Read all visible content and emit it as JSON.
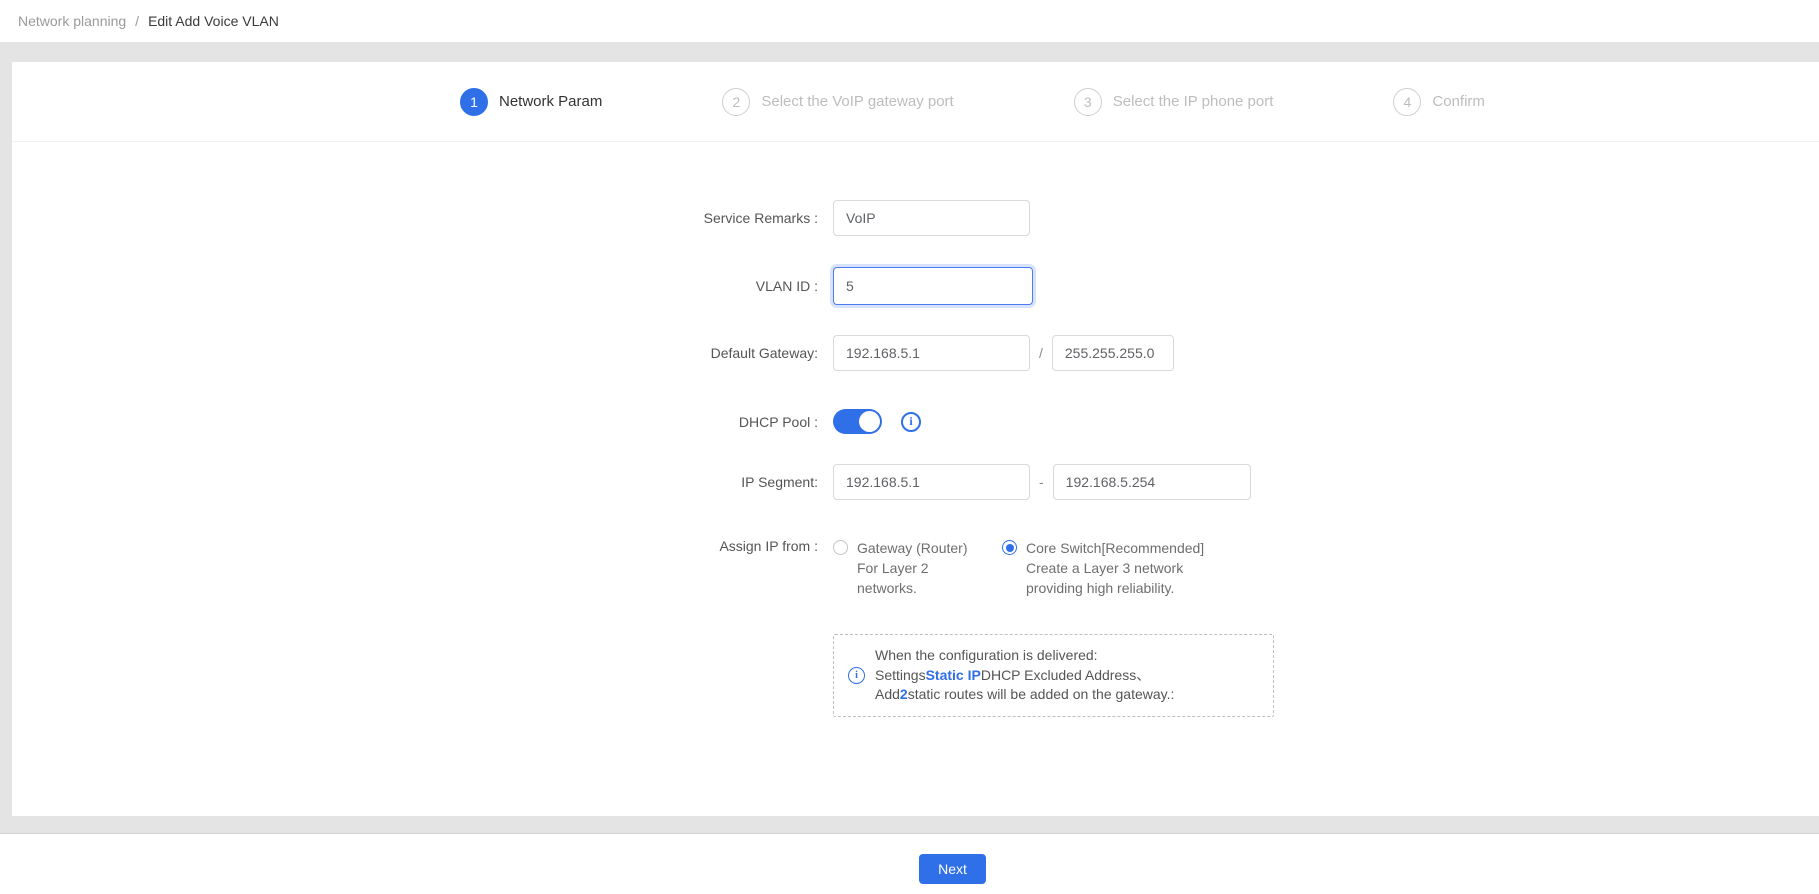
{
  "breadcrumb": {
    "parent": "Network planning",
    "separator": "/",
    "current": "Edit Add Voice VLAN"
  },
  "steps": [
    {
      "number": "1",
      "label": "Network Param",
      "active": true
    },
    {
      "number": "2",
      "label": "Select the VoIP gateway port",
      "active": false
    },
    {
      "number": "3",
      "label": "Select the IP phone port",
      "active": false
    },
    {
      "number": "4",
      "label": "Confirm",
      "active": false
    }
  ],
  "form": {
    "service_remarks": {
      "label": "Service Remarks :",
      "value": "VoIP"
    },
    "vlan_id": {
      "label": "VLAN ID :",
      "value": "5"
    },
    "default_gateway": {
      "label": "Default Gateway:",
      "ip": "192.168.5.1",
      "separator": "/",
      "mask": "255.255.255.0"
    },
    "dhcp_pool": {
      "label": "DHCP Pool :",
      "enabled": true
    },
    "ip_segment": {
      "label": "IP Segment:",
      "start": "192.168.5.1",
      "separator": "-",
      "end": "192.168.5.254"
    },
    "assign_ip_from": {
      "label": "Assign IP from :",
      "options": [
        {
          "selected": false,
          "lines": [
            "Gateway (Router)",
            "For Layer 2",
            "networks."
          ]
        },
        {
          "selected": true,
          "lines": [
            "Core Switch[Recommended]",
            "Create a Layer 3 network",
            "providing high reliability."
          ]
        }
      ]
    }
  },
  "notice": {
    "line1": "When the configuration is delivered:",
    "line2_prefix": "Settings",
    "line2_highlight": "Static IP",
    "line2_suffix": "DHCP Excluded Address、",
    "line3_prefix": "Add",
    "line3_highlight": "2",
    "line3_suffix": "static routes will be added on the gateway.:"
  },
  "footer": {
    "next_label": "Next"
  },
  "icons": {
    "info": "i"
  },
  "colors": {
    "accent": "#2f6fe8",
    "page_background": "#e4e4e4",
    "step_inactive": "#bdbdbd"
  }
}
